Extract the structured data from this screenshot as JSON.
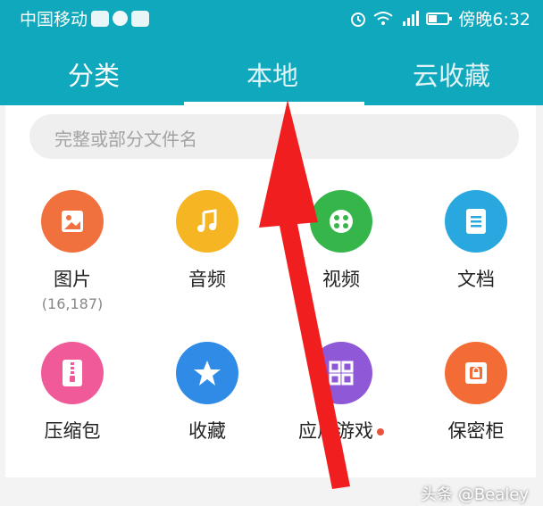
{
  "status_bar": {
    "carrier": "中国移动",
    "time": "傍晚6:32",
    "icons": [
      "notification-icon",
      "chat-icon",
      "app-icon",
      "alarm-icon",
      "wifi-icon",
      "signal-icon",
      "battery-icon"
    ]
  },
  "tabs": [
    {
      "label": "分类"
    },
    {
      "label": "本地"
    },
    {
      "label": "云收藏"
    }
  ],
  "search": {
    "placeholder": "完整或部分文件名"
  },
  "categories": [
    {
      "label": "图片",
      "count": "(16,187)",
      "icon": "image-icon",
      "color": "#f0703e"
    },
    {
      "label": "音频",
      "icon": "music-icon",
      "color": "#f6b623"
    },
    {
      "label": "视频",
      "icon": "video-icon",
      "color": "#35b54a"
    },
    {
      "label": "文档",
      "icon": "document-icon",
      "color": "#29a8e0"
    },
    {
      "label": "压缩包",
      "icon": "zip-icon",
      "color": "#f05a98"
    },
    {
      "label": "收藏",
      "icon": "star-icon",
      "color": "#2f8be6"
    },
    {
      "label": "应用游戏",
      "icon": "apps-icon",
      "color": "#8f58d7"
    },
    {
      "label": "保密柜",
      "icon": "safe-icon",
      "color": "#f36b35"
    }
  ],
  "watermark": "头条 @Bealey"
}
